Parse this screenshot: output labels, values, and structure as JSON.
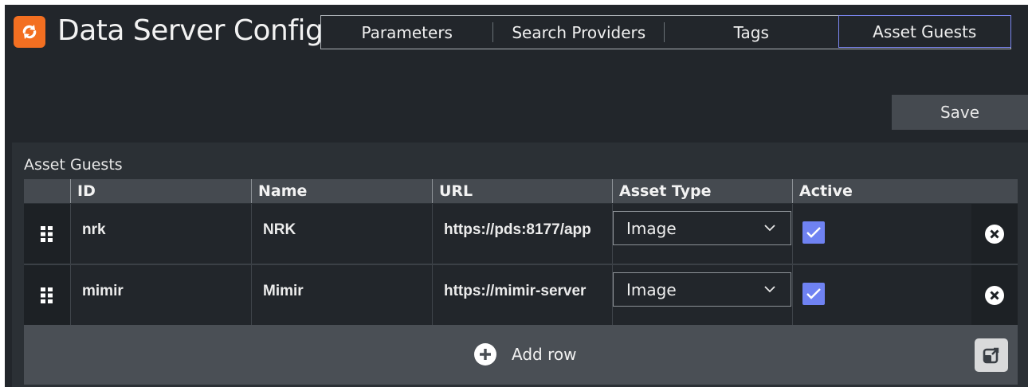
{
  "header": {
    "title": "Data Server Config",
    "logo_icon": "refresh-arrows-icon",
    "tabs": [
      {
        "label": "Parameters"
      },
      {
        "label": "Search Providers"
      },
      {
        "label": "Tags"
      },
      {
        "label": "Asset Guests",
        "active": true
      }
    ]
  },
  "toolbar": {
    "save_label": "Save"
  },
  "panel": {
    "title": "Asset Guests",
    "columns": {
      "id": "ID",
      "name": "Name",
      "url": "URL",
      "asset_type": "Asset Type",
      "active": "Active"
    },
    "rows": [
      {
        "id": "nrk",
        "name": "NRK",
        "url": "https://pds:8177/app",
        "asset_type": "Image",
        "active": true
      },
      {
        "id": "mimir",
        "name": "Mimir",
        "url": "https://mimir-server",
        "asset_type": "Image",
        "active": true
      }
    ],
    "add_row_label": "Add row"
  },
  "colors": {
    "accent": "#f36f21",
    "checkbox": "#6f82f2",
    "active_tab_border": "#7b86f0"
  }
}
